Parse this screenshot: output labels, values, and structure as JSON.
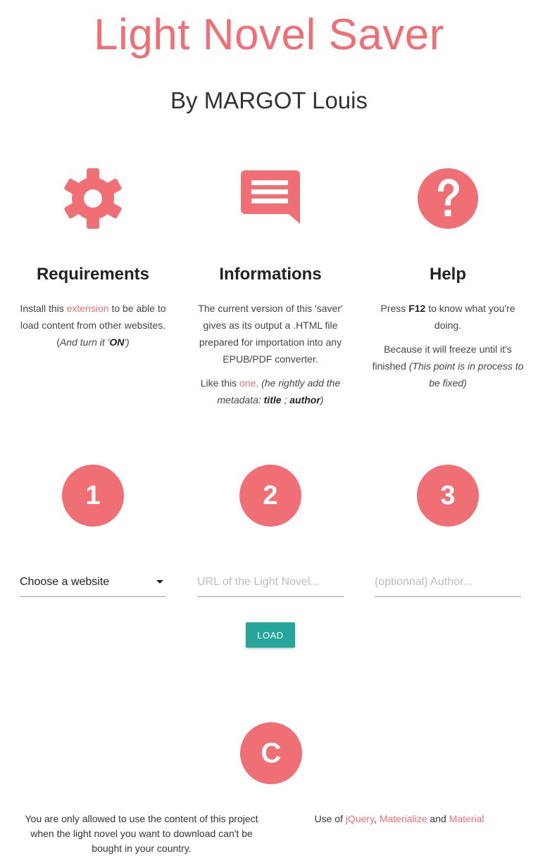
{
  "header": {
    "title": "Light Novel Saver",
    "subtitle": "By MARGOT Louis"
  },
  "features": {
    "requirements": {
      "icon": "gear-icon",
      "heading": "Requirements",
      "text_before_link": "Install this ",
      "link": "extension",
      "text_after_link": " to be able to load content from other websites.",
      "note_open": "(",
      "note_italic": "And turn it '",
      "note_bold": "ON",
      "note_close": "')"
    },
    "informations": {
      "icon": "message-icon",
      "heading": "Informations",
      "paragraph1": "The current version of this 'saver' gives as its output a .HTML file prepared for importation into any EPUB/PDF converter.",
      "p2_before_link": "Like this ",
      "p2_link": "one",
      "p2_comma": ",",
      "p2_italic": " (he rightly add the metadata: ",
      "p2_bold1": "title",
      "p2_sep": " ; ",
      "p2_bold2": "author",
      "p2_close": ")"
    },
    "help": {
      "icon": "help-icon",
      "heading": "Help",
      "p1_before": "Press ",
      "p1_bold": "F12",
      "p1_after": " to know what you're doing.",
      "p2_plain": "Because it will freeze until it's finished ",
      "p2_italic": "(This point is in process to be fixed)"
    }
  },
  "steps": [
    "1",
    "2",
    "3"
  ],
  "form": {
    "website_select": "Choose a website",
    "url_placeholder": "URL of the Light Novel...",
    "author_placeholder": "(optionnal) Author...",
    "load_label": "LOAD"
  },
  "footer": {
    "circle": "C",
    "disclaimer": "You are only allowed to use the content of this project when the light novel you want to download can't be bought in your country.",
    "credits_prefix": "Use of ",
    "credits_link1": "jQuery",
    "credits_sep1": ", ",
    "credits_link2": "Materialize",
    "credits_sep2": " and ",
    "credits_link3": "Material"
  },
  "colors": {
    "accent": "#ef6f74",
    "button": "#26a69a"
  }
}
